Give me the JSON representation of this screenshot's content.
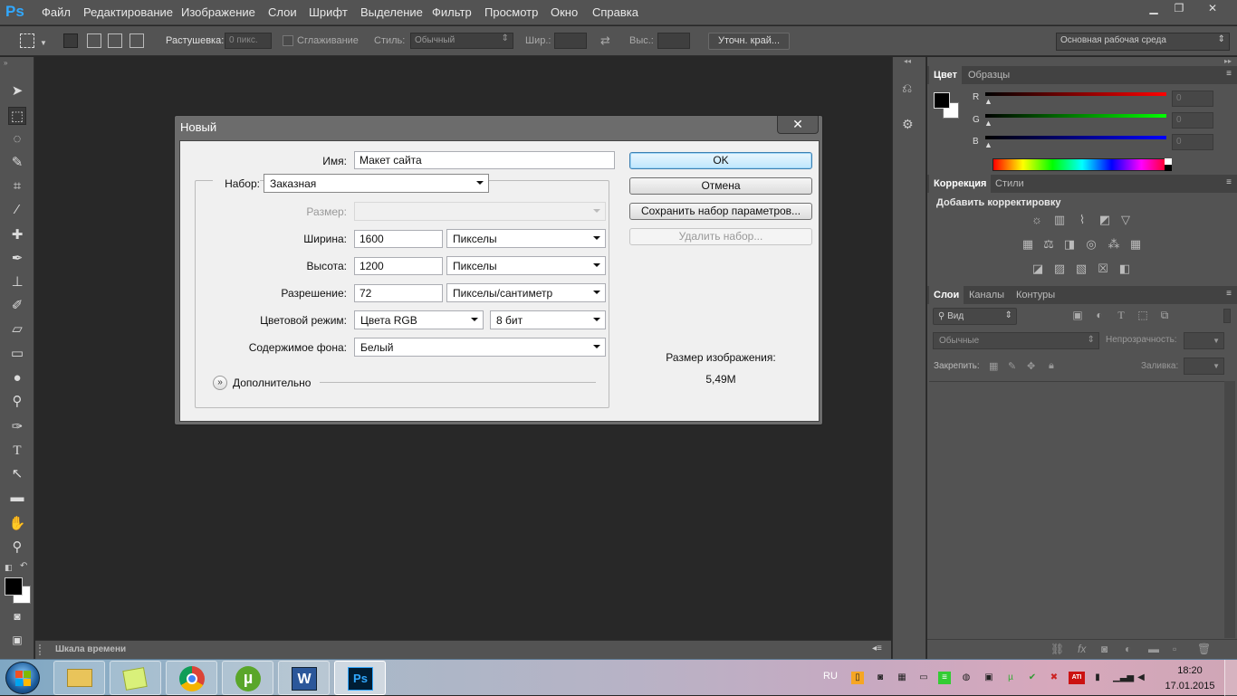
{
  "app": {
    "logo": "Ps"
  },
  "menu": [
    "Файл",
    "Редактирование",
    "Изображение",
    "Слои",
    "Шрифт",
    "Выделение",
    "Фильтр",
    "Просмотр",
    "Окно",
    "Справка"
  ],
  "options": {
    "feather_label": "Растушевка:",
    "feather_value": "0 пикс.",
    "antialias_label": "Сглаживание",
    "style_label": "Стиль:",
    "style_value": "Обычный",
    "width_label": "Шир.:",
    "height_label": "Выс.:",
    "refine_label": "Уточн. край...",
    "workspace": "Основная рабочая среда"
  },
  "timeline_label": "Шкала времени",
  "color_panel": {
    "tabs": [
      "Цвет",
      "Образцы"
    ],
    "channels": [
      {
        "label": "R",
        "value": "0",
        "color": "#e02020"
      },
      {
        "label": "G",
        "value": "0",
        "color": "#20c020"
      },
      {
        "label": "B",
        "value": "0",
        "color": "#2030e0"
      }
    ]
  },
  "adjust_panel": {
    "tabs": [
      "Коррекция",
      "Стили"
    ],
    "heading": "Добавить корректировку"
  },
  "layers_panel": {
    "tabs": [
      "Слои",
      "Каналы",
      "Контуры"
    ],
    "filter": "Вид",
    "blend": "Обычные",
    "opacity_label": "Непрозрачность:",
    "lock_label": "Закрепить:",
    "fill_label": "Заливка:"
  },
  "dialog": {
    "title": "Новый",
    "close": "✕",
    "name_label": "Имя:",
    "name_value": "Макет сайта",
    "preset_label": "Набор:",
    "preset_value": "Заказная",
    "size_label": "Размер:",
    "width_label": "Ширина:",
    "width_value": "1600",
    "width_unit": "Пикселы",
    "height_label": "Высота:",
    "height_value": "1200",
    "height_unit": "Пикселы",
    "res_label": "Разрешение:",
    "res_value": "72",
    "res_unit": "Пикселы/сантиметр",
    "mode_label": "Цветовой режим:",
    "mode_value": "Цвета RGB",
    "depth_value": "8 бит",
    "bg_label": "Содержимое фона:",
    "bg_value": "Белый",
    "advanced_label": "Дополнительно",
    "ok": "OK",
    "cancel": "Отмена",
    "save_preset": "Сохранить набор параметров...",
    "delete_preset": "Удалить набор...",
    "img_size_label": "Размер изображения:",
    "img_size_value": "5,49M"
  },
  "taskbar": {
    "lang": "RU",
    "time": "18:20",
    "date": "17.01.2015"
  }
}
